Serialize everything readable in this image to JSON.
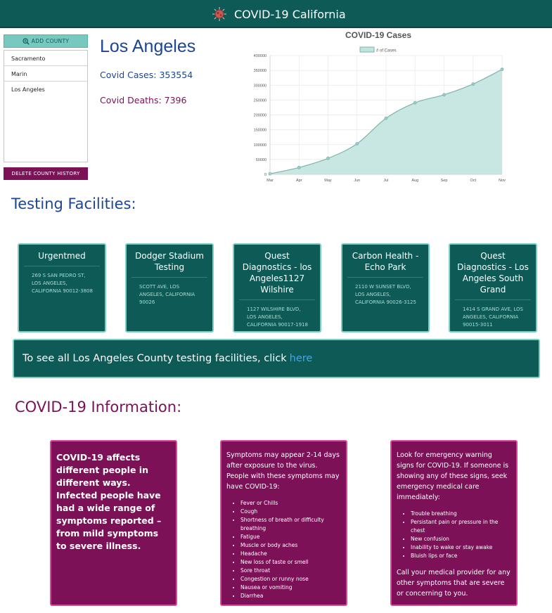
{
  "header": {
    "title": "COVID-19 California",
    "logo_icon": "virus-icon"
  },
  "sidebar": {
    "add_label": "Add County",
    "counties": [
      "Sacramento",
      "Marin",
      "Los Angeles"
    ],
    "delete_label": "Delete County History"
  },
  "county": {
    "name": "Los Angeles",
    "cases_text": "Covid Cases: 353554",
    "deaths_text": "Covid Deaths: 7396"
  },
  "chart_data": {
    "type": "area",
    "title": "COVID-19 Cases",
    "categories": [
      "Mar",
      "Apr",
      "May",
      "Jun",
      "Jul",
      "Aug",
      "Sep",
      "Oct",
      "Nov"
    ],
    "series": [
      {
        "name": "# of Cases",
        "values": [
          2000,
          23000,
          54000,
          103000,
          189000,
          241000,
          268000,
          304000,
          353554
        ]
      }
    ],
    "yticks": [
      "0",
      "50000",
      "100000",
      "150000",
      "200000",
      "250000",
      "300000",
      "350000",
      "400000"
    ],
    "ylim": [
      0,
      400000
    ],
    "grid": true,
    "legend": "top",
    "colors": {
      "fill": "#c2e4df",
      "line": "#7db4ac"
    }
  },
  "testing": {
    "title": "Testing Facilities:",
    "facilities": [
      {
        "name": "Urgentmed",
        "address": "269 S San Pedro St, Los Angeles, California 90012-3808"
      },
      {
        "name": "Dodger Stadium Testing",
        "address": "Scott Ave, Los Angeles, California 90026"
      },
      {
        "name": "Quest Diagnostics - los Angeles1127 Wilshire",
        "address": "1127 Wilshire Blvd, Los Angeles, California 90017-1918"
      },
      {
        "name": "Carbon Health - Echo Park",
        "address": "2110 W Sunset Blvd, Los Angeles, California 90026-3125"
      },
      {
        "name": "Quest Diagnostics - Los Angeles South Grand",
        "address": "1414 S Grand Ave, Los Angeles, California 90015-3011"
      }
    ],
    "banner_text": "To see all Los Angeles County testing facilities, click",
    "banner_link": "here"
  },
  "info": {
    "title": "COVID-19 Information:",
    "card1": "COVID-19 affects different people in different ways. Infected people have had a wide range of symptoms reported – from mild symptoms to severe illness.",
    "card2": {
      "lead": "Symptoms may appear 2-14 days after exposure to the virus. People with these symptoms may have COVID-19:",
      "items": [
        "Fever or Chills",
        "Cough",
        "Shortness of breath or difficulty breathing",
        "Fatigue",
        "Muscle or body aches",
        "Headache",
        "New loss of taste or smell",
        "Sore throat",
        "Congestion or runny nose",
        "Nausea or vomiting",
        "Diarrhea"
      ]
    },
    "card3": {
      "lead": "Look for emergency warning signs for COVID-19. If someone is showing any of these signs, seek emergency medical care immediately:",
      "items": [
        "Trouble breathing",
        "Persistant pain or pressure in the chest",
        "New confusion",
        "Inability to wake or stay awake",
        "Bluish lips or face"
      ],
      "foot": "Call your medical provider for any other symptoms that are severe or concerning to you."
    }
  },
  "colors": {
    "teal": "#0e5a57",
    "mint": "#7ecdc1",
    "blue": "#1d4596",
    "purple": "#7c1158",
    "pink_border": "#e0459f",
    "link": "#3ea7f5"
  }
}
